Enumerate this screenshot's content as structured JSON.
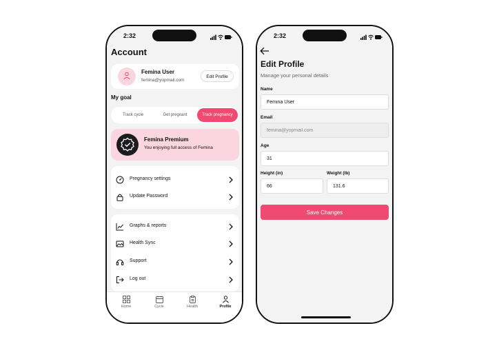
{
  "colors": {
    "accent": "#f14a72",
    "accent_soft": "#fbd5df",
    "screen_bg": "#f3f3f4"
  },
  "status_bar": {
    "time": "2:32",
    "icons": [
      "signal-icon",
      "wifi-icon",
      "battery-icon"
    ]
  },
  "account": {
    "title": "Account",
    "profile": {
      "name": "Femina User",
      "email": "femina@yopmail.com",
      "edit_label": "Edit Profile",
      "icon": "user-icon"
    },
    "goal": {
      "label": "My goal",
      "options": [
        "Track cycle",
        "Get pregnant",
        "Track pregnancy"
      ],
      "selected": "Track pregnancy"
    },
    "premium": {
      "title": "Femina Premium",
      "subtitle": "You enjoying full access of Femina",
      "icon": "verified-badge-icon"
    },
    "menu_group_1": [
      {
        "label": "Pregnancy settings",
        "icon": "gauge-icon"
      },
      {
        "label": "Update Password",
        "icon": "lock-icon"
      }
    ],
    "menu_group_2": [
      {
        "label": "Graphs & reports",
        "icon": "chart-icon"
      },
      {
        "label": "Health Sync",
        "icon": "image-icon"
      },
      {
        "label": "Support",
        "icon": "headset-icon"
      },
      {
        "label": "Log out",
        "icon": "logout-icon"
      }
    ],
    "tabs": [
      {
        "label": "Home",
        "icon": "grid-icon"
      },
      {
        "label": "Cycle",
        "icon": "calendar-icon"
      },
      {
        "label": "Health",
        "icon": "clipboard-icon"
      },
      {
        "label": "Profile",
        "icon": "person-icon"
      }
    ],
    "active_tab": "Profile"
  },
  "edit_profile": {
    "title": "Edit Profile",
    "subtitle": "Manage your personal details",
    "fields": {
      "name": {
        "label": "Name",
        "value": "Femina User"
      },
      "email": {
        "label": "Email",
        "value": "femina@yopmail.com"
      },
      "age": {
        "label": "Age",
        "value": "31"
      },
      "height": {
        "label": "Height (in)",
        "value": "66"
      },
      "weight": {
        "label": "Weight (lb)",
        "value": "131.6"
      }
    },
    "save_label": "Save Changes"
  }
}
